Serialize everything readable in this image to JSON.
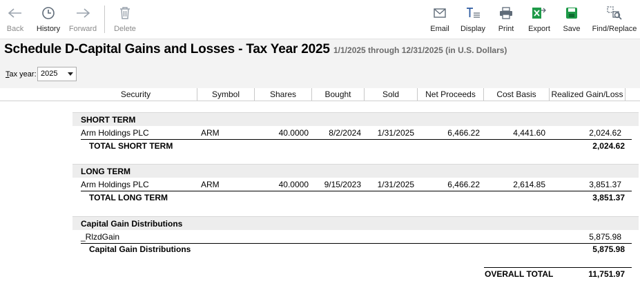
{
  "toolbar": {
    "back": "Back",
    "history": "History",
    "forward": "Forward",
    "delete": "Delete",
    "email": "Email",
    "display": "Display",
    "print": "Print",
    "export": "Export",
    "save": "Save",
    "find_replace": "Find/Replace"
  },
  "header": {
    "title": "Schedule D-Capital Gains and Losses - Tax Year 2025",
    "date_range": "1/1/2025 through 12/31/2025 (in U.S. Dollars)"
  },
  "filter": {
    "tax_year_label_prefix": "T",
    "tax_year_label_rest": "ax year:",
    "tax_year_value": "2025"
  },
  "columns": [
    "Security",
    "Symbol",
    "Shares",
    "Bought",
    "Sold",
    "Net Proceeds",
    "Cost Basis",
    "Realized Gain/Loss"
  ],
  "short_term": {
    "heading": "SHORT TERM",
    "row": {
      "security": "Arm Holdings PLC",
      "symbol": "ARM",
      "shares": "40.0000",
      "bought": "8/2/2024",
      "sold": "1/31/2025",
      "net_proceeds": "6,466.22",
      "cost_basis": "4,441.60",
      "gain": "2,024.62"
    },
    "total_label": "TOTAL SHORT TERM",
    "total_value": "2,024.62"
  },
  "long_term": {
    "heading": "LONG TERM",
    "row": {
      "security": "Arm Holdings PLC",
      "symbol": "ARM",
      "shares": "40.0000",
      "bought": "9/15/2023",
      "sold": "1/31/2025",
      "net_proceeds": "6,466.22",
      "cost_basis": "2,614.85",
      "gain": "3,851.37"
    },
    "total_label": "TOTAL LONG TERM",
    "total_value": "3,851.37"
  },
  "distributions": {
    "heading": "Capital Gain Distributions",
    "row": {
      "security": "_RlzdGain",
      "gain": "5,875.98"
    },
    "total_label": "Capital Gain Distributions",
    "total_value": "5,875.98"
  },
  "overall": {
    "label": "OVERALL TOTAL",
    "value": "11,751.97"
  },
  "colors": {
    "save_green": "#1e9a48",
    "export_green": "#1e9a48",
    "icon_gray": "#5f6b78",
    "disabled_gray": "#9aa3ad"
  }
}
